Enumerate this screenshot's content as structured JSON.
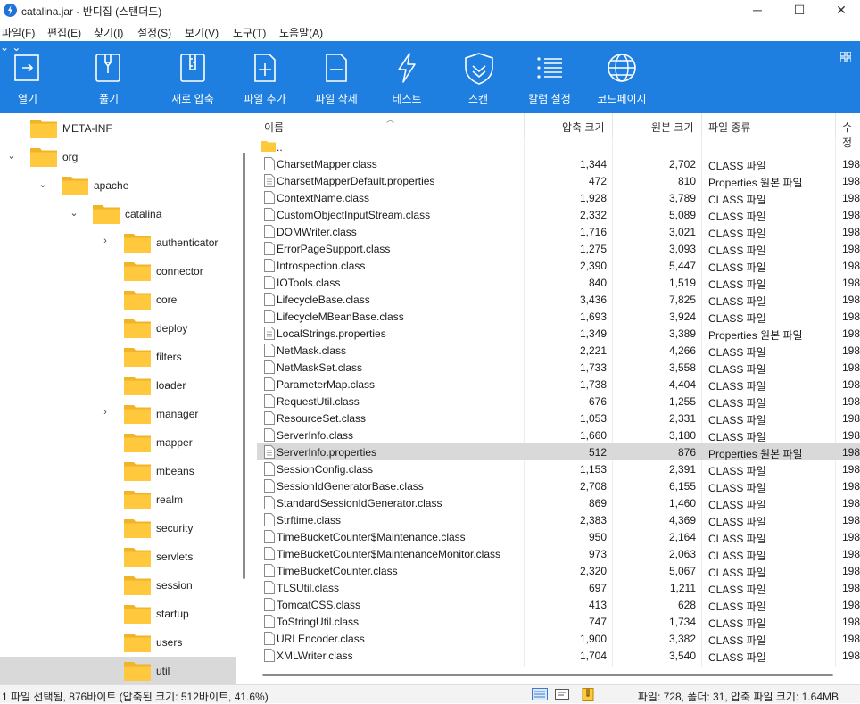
{
  "window": {
    "title": "catalina.jar - 반디집 (스탠더드)",
    "minimize": "─",
    "maximize": "☐",
    "close": "✕"
  },
  "menu": [
    "파일(F)",
    "편집(E)",
    "찾기(I)",
    "설정(S)",
    "보기(V)",
    "도구(T)",
    "도움말(A)"
  ],
  "toolbar": {
    "open": "열기",
    "extract": "풀기",
    "new_archive": "새로 압축",
    "add_file": "파일 추가",
    "delete_file": "파일 삭제",
    "test": "테스트",
    "scan": "스캔",
    "column_settings": "칼럼 설정",
    "codepage": "코드페이지"
  },
  "tree": [
    {
      "label": "META-INF",
      "expander": ""
    },
    {
      "label": "org",
      "expander": "⌄"
    },
    {
      "label": "apache",
      "expander": "⌄"
    },
    {
      "label": "catalina",
      "expander": "⌄"
    },
    {
      "label": "authenticator",
      "expander": "›"
    },
    {
      "label": "connector",
      "expander": ""
    },
    {
      "label": "core",
      "expander": ""
    },
    {
      "label": "deploy",
      "expander": ""
    },
    {
      "label": "filters",
      "expander": ""
    },
    {
      "label": "loader",
      "expander": ""
    },
    {
      "label": "manager",
      "expander": "›"
    },
    {
      "label": "mapper",
      "expander": ""
    },
    {
      "label": "mbeans",
      "expander": ""
    },
    {
      "label": "realm",
      "expander": ""
    },
    {
      "label": "security",
      "expander": ""
    },
    {
      "label": "servlets",
      "expander": ""
    },
    {
      "label": "session",
      "expander": ""
    },
    {
      "label": "startup",
      "expander": ""
    },
    {
      "label": "users",
      "expander": ""
    },
    {
      "label": "util",
      "expander": ""
    }
  ],
  "columns": {
    "name": "이름",
    "compressed": "압축 크기",
    "original": "원본 크기",
    "type": "파일 종류",
    "modified": "수정"
  },
  "parent_dir": "..",
  "files": [
    {
      "name": "CharsetMapper.class",
      "c": "1,344",
      "o": "2,702",
      "t": "CLASS 파일",
      "m": "198"
    },
    {
      "name": "CharsetMapperDefault.properties",
      "c": "472",
      "o": "810",
      "t": "Properties 원본 파일",
      "m": "198"
    },
    {
      "name": "ContextName.class",
      "c": "1,928",
      "o": "3,789",
      "t": "CLASS 파일",
      "m": "198"
    },
    {
      "name": "CustomObjectInputStream.class",
      "c": "2,332",
      "o": "5,089",
      "t": "CLASS 파일",
      "m": "198"
    },
    {
      "name": "DOMWriter.class",
      "c": "1,716",
      "o": "3,021",
      "t": "CLASS 파일",
      "m": "198"
    },
    {
      "name": "ErrorPageSupport.class",
      "c": "1,275",
      "o": "3,093",
      "t": "CLASS 파일",
      "m": "198"
    },
    {
      "name": "Introspection.class",
      "c": "2,390",
      "o": "5,447",
      "t": "CLASS 파일",
      "m": "198"
    },
    {
      "name": "IOTools.class",
      "c": "840",
      "o": "1,519",
      "t": "CLASS 파일",
      "m": "198"
    },
    {
      "name": "LifecycleBase.class",
      "c": "3,436",
      "o": "7,825",
      "t": "CLASS 파일",
      "m": "198"
    },
    {
      "name": "LifecycleMBeanBase.class",
      "c": "1,693",
      "o": "3,924",
      "t": "CLASS 파일",
      "m": "198"
    },
    {
      "name": "LocalStrings.properties",
      "c": "1,349",
      "o": "3,389",
      "t": "Properties 원본 파일",
      "m": "198"
    },
    {
      "name": "NetMask.class",
      "c": "2,221",
      "o": "4,266",
      "t": "CLASS 파일",
      "m": "198"
    },
    {
      "name": "NetMaskSet.class",
      "c": "1,733",
      "o": "3,558",
      "t": "CLASS 파일",
      "m": "198"
    },
    {
      "name": "ParameterMap.class",
      "c": "1,738",
      "o": "4,404",
      "t": "CLASS 파일",
      "m": "198"
    },
    {
      "name": "RequestUtil.class",
      "c": "676",
      "o": "1,255",
      "t": "CLASS 파일",
      "m": "198"
    },
    {
      "name": "ResourceSet.class",
      "c": "1,053",
      "o": "2,331",
      "t": "CLASS 파일",
      "m": "198"
    },
    {
      "name": "ServerInfo.class",
      "c": "1,660",
      "o": "3,180",
      "t": "CLASS 파일",
      "m": "198"
    },
    {
      "name": "ServerInfo.properties",
      "c": "512",
      "o": "876",
      "t": "Properties 원본 파일",
      "m": "198"
    },
    {
      "name": "SessionConfig.class",
      "c": "1,153",
      "o": "2,391",
      "t": "CLASS 파일",
      "m": "198"
    },
    {
      "name": "SessionIdGeneratorBase.class",
      "c": "2,708",
      "o": "6,155",
      "t": "CLASS 파일",
      "m": "198"
    },
    {
      "name": "StandardSessionIdGenerator.class",
      "c": "869",
      "o": "1,460",
      "t": "CLASS 파일",
      "m": "198"
    },
    {
      "name": "Strftime.class",
      "c": "2,383",
      "o": "4,369",
      "t": "CLASS 파일",
      "m": "198"
    },
    {
      "name": "TimeBucketCounter$Maintenance.class",
      "c": "950",
      "o": "2,164",
      "t": "CLASS 파일",
      "m": "198"
    },
    {
      "name": "TimeBucketCounter$MaintenanceMonitor.class",
      "c": "973",
      "o": "2,063",
      "t": "CLASS 파일",
      "m": "198"
    },
    {
      "name": "TimeBucketCounter.class",
      "c": "2,320",
      "o": "5,067",
      "t": "CLASS 파일",
      "m": "198"
    },
    {
      "name": "TLSUtil.class",
      "c": "697",
      "o": "1,211",
      "t": "CLASS 파일",
      "m": "198"
    },
    {
      "name": "TomcatCSS.class",
      "c": "413",
      "o": "628",
      "t": "CLASS 파일",
      "m": "198"
    },
    {
      "name": "ToStringUtil.class",
      "c": "747",
      "o": "1,734",
      "t": "CLASS 파일",
      "m": "198"
    },
    {
      "name": "URLEncoder.class",
      "c": "1,900",
      "o": "3,382",
      "t": "CLASS 파일",
      "m": "198"
    },
    {
      "name": "XMLWriter.class",
      "c": "1,704",
      "o": "3,540",
      "t": "CLASS 파일",
      "m": "198"
    }
  ],
  "selected_file": "ServerInfo.properties",
  "selected_folder": "util",
  "status": {
    "left": "1 파일 선택됨, 876바이트 (압축된 크기: 512바이트, 41.6%)",
    "right": "파일: 728, 폴더: 31, 압축 파일 크기: 1.64MB"
  },
  "colors": {
    "toolbar": "#1e7fe0",
    "folder": "#ffc83d",
    "selection": "#d9d9d9"
  }
}
